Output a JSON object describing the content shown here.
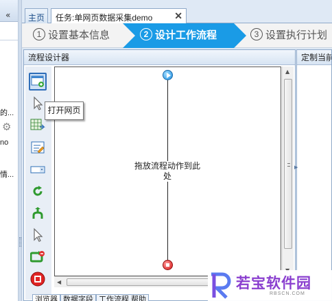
{
  "left_panel": {
    "collapse_icon": "double-chevron-left-icon",
    "text_1": "的...",
    "text_2": "no",
    "text_3": "情..."
  },
  "tabs": [
    {
      "label": "主页"
    },
    {
      "label": "任务:单网页数据采集demo",
      "close": "✕"
    }
  ],
  "wizard": {
    "steps": [
      {
        "num": "1",
        "label": "设置基本信息"
      },
      {
        "num": "2",
        "label": "设计工作流程",
        "active": true
      },
      {
        "num": "3",
        "label": "设置执行计划"
      }
    ],
    "active_color": "#1a9be6"
  },
  "designer": {
    "title": "流程设计器",
    "tooltip": "打开网页",
    "drop_hint": "拖放流程动作到此处",
    "tools": [
      "open-page-icon",
      "click-element-icon",
      "extract-data-icon",
      "input-text-icon",
      "switch-dropdown-icon",
      "loop-icon",
      "branch-icon",
      "mouse-hover-icon",
      "loop-click-icon",
      "end-flow-icon"
    ]
  },
  "properties": {
    "title": "定制当前操作"
  },
  "bottom_tabs": [
    "浏览器",
    "数据字段",
    "工作流程 帮助"
  ],
  "watermark": {
    "text": "若宝软件园",
    "sub": "RBSCN.COM"
  }
}
